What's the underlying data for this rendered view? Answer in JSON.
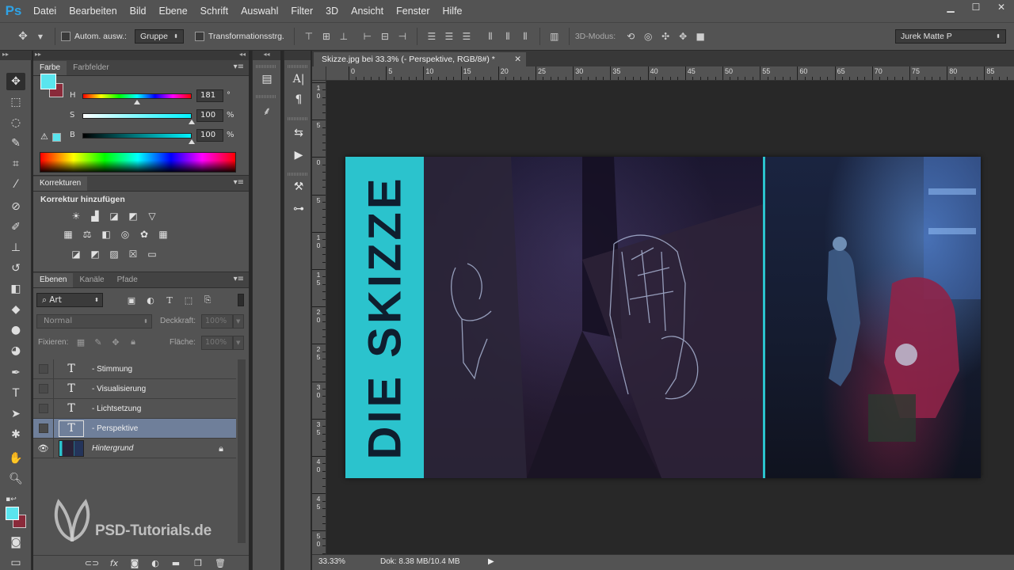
{
  "app": {
    "logo": "Ps",
    "menu": [
      "Datei",
      "Bearbeiten",
      "Bild",
      "Ebene",
      "Schrift",
      "Auswahl",
      "Filter",
      "3D",
      "Ansicht",
      "Fenster",
      "Hilfe"
    ],
    "window_controls": [
      "minimize",
      "maximize",
      "close"
    ]
  },
  "options": {
    "auto_select_label": "Autom. ausw.:",
    "auto_select_target": "Gruppe",
    "transform_label": "Transformationsstrg.",
    "mode_3d_label": "3D-Modus:",
    "workspace": "Jurek Matte P"
  },
  "color_panel": {
    "tabs": [
      "Farbe",
      "Farbfelder"
    ],
    "foreground": "#5ae5ee",
    "background": "#8a2a3a",
    "sliders": [
      {
        "label": "H",
        "value": "181",
        "unit": "°",
        "fraction": 0.5
      },
      {
        "label": "S",
        "value": "100",
        "unit": "%",
        "fraction": 1.0
      },
      {
        "label": "B",
        "value": "100",
        "unit": "%",
        "fraction": 1.0
      }
    ]
  },
  "adjustments": {
    "tab": "Korrekturen",
    "title": "Korrektur hinzufügen",
    "icons_row1": [
      "brightness-icon",
      "levels-icon",
      "curves-icon",
      "exposure-icon",
      "vibrance-icon"
    ],
    "icons_row2": [
      "hue-saturation-icon",
      "color-balance-icon",
      "black-white-icon",
      "photo-filter-icon",
      "channel-mixer-icon",
      "color-lookup-icon"
    ],
    "icons_row3": [
      "invert-icon",
      "posterize-icon",
      "threshold-icon",
      "selective-color-icon",
      "gradient-map-icon"
    ]
  },
  "layers": {
    "tabs": [
      "Ebenen",
      "Kanäle",
      "Pfade"
    ],
    "filter_type": "Art",
    "blend_mode": "Normal",
    "opacity_label": "Deckkraft:",
    "opacity_value": "100%",
    "lock_label": "Fixieren:",
    "fill_label": "Fläche:",
    "fill_value": "100%",
    "items": [
      {
        "name": "- Stimmung",
        "type": "text",
        "visible": false,
        "selected": false
      },
      {
        "name": "- Visualisierung",
        "type": "text",
        "visible": false,
        "selected": false
      },
      {
        "name": "- Lichtsetzung",
        "type": "text",
        "visible": false,
        "selected": false
      },
      {
        "name": "- Perspektive",
        "type": "text",
        "visible": false,
        "selected": true
      },
      {
        "name": "Hintergrund",
        "type": "image",
        "visible": true,
        "selected": false,
        "locked": true
      }
    ]
  },
  "watermark": "PSD-Tutorials.de",
  "document": {
    "tab_title": "Skizze.jpg bei 33.3% (- Perspektive, RGB/8#) *",
    "ruler_h": [
      "0",
      "5",
      "10",
      "15",
      "20",
      "25",
      "30",
      "35",
      "40",
      "45",
      "50",
      "55",
      "60",
      "65",
      "70",
      "75",
      "80",
      "85"
    ],
    "ruler_v": [
      [
        "1",
        "0"
      ],
      [
        "5"
      ],
      [
        "0"
      ],
      [
        "5"
      ],
      [
        "1",
        "0"
      ],
      [
        "1",
        "5"
      ],
      [
        "2",
        "0"
      ],
      [
        "2",
        "5"
      ],
      [
        "3",
        "0"
      ],
      [
        "3",
        "5"
      ],
      [
        "4",
        "0"
      ],
      [
        "4",
        "5"
      ],
      [
        "5",
        "0"
      ]
    ],
    "artwork_title": "DIE SKIZZE",
    "accent_color": "#2bc3cd"
  },
  "status": {
    "zoom": "33.33%",
    "doc_info": "Dok: 8.38 MB/10.4 MB"
  }
}
